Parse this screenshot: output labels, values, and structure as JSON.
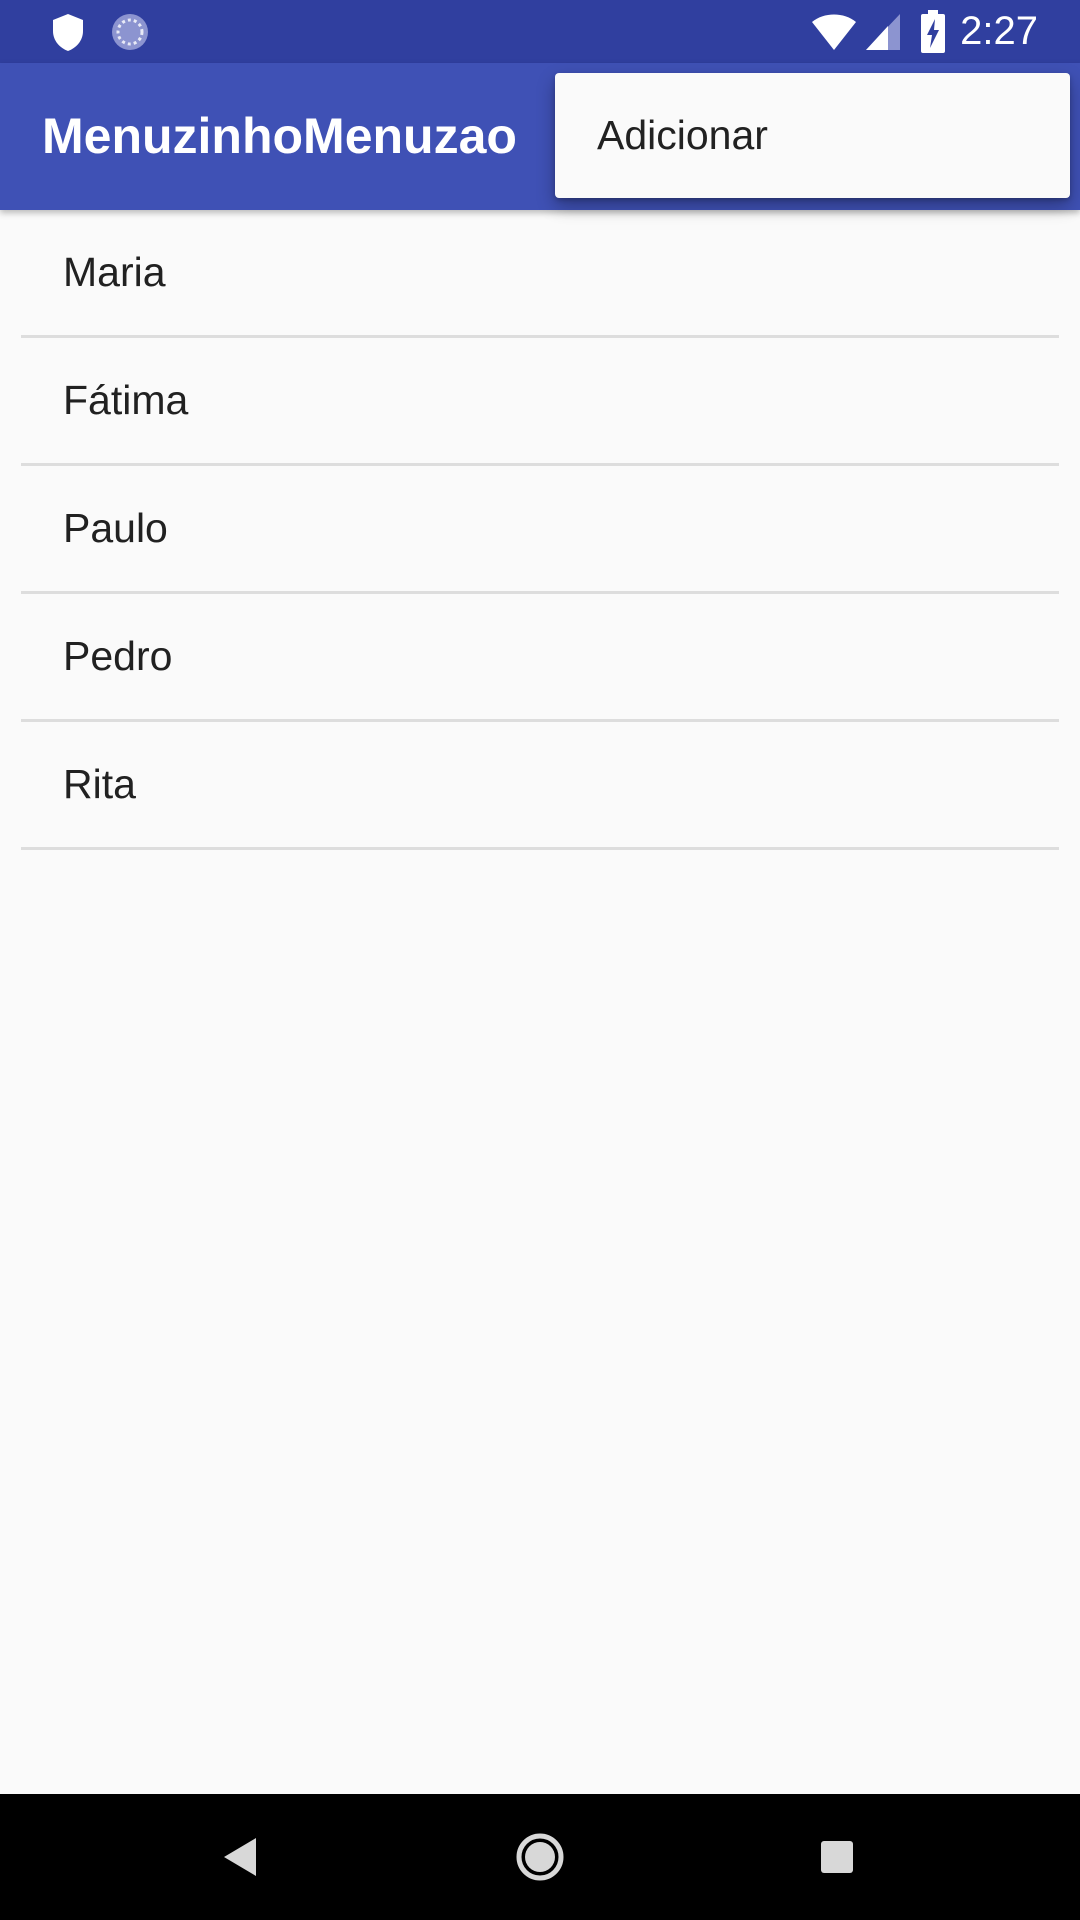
{
  "status_bar": {
    "time": "2:27",
    "icons": [
      "shield-icon",
      "sync-icon",
      "wifi-icon",
      "cell-signal-icon",
      "battery-charging-icon"
    ],
    "background": "#303f9f"
  },
  "app_bar": {
    "title": "MenuzinhoMenuzao",
    "background": "#3f51b5"
  },
  "popup_menu": {
    "items": [
      {
        "label": "Adicionar"
      }
    ]
  },
  "list": {
    "items": [
      {
        "label": "Maria"
      },
      {
        "label": "Fátima"
      },
      {
        "label": "Paulo"
      },
      {
        "label": "Pedro"
      },
      {
        "label": "Rita"
      }
    ]
  },
  "nav_bar": {
    "buttons": [
      "back-icon",
      "home-icon",
      "recents-icon"
    ]
  }
}
